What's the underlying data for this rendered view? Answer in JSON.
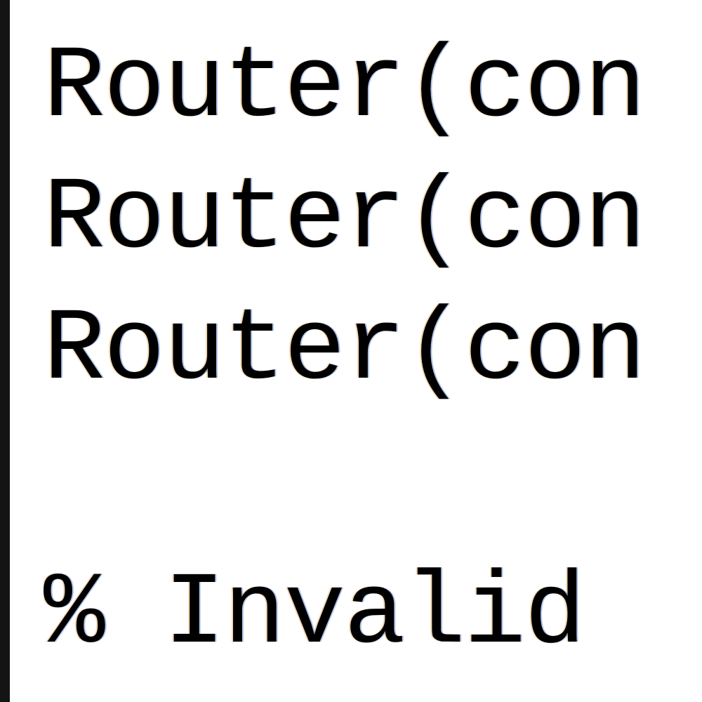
{
  "console": {
    "lines": [
      "Router(con",
      "Router(con",
      "Router(con",
      "",
      "% Invalid"
    ]
  }
}
